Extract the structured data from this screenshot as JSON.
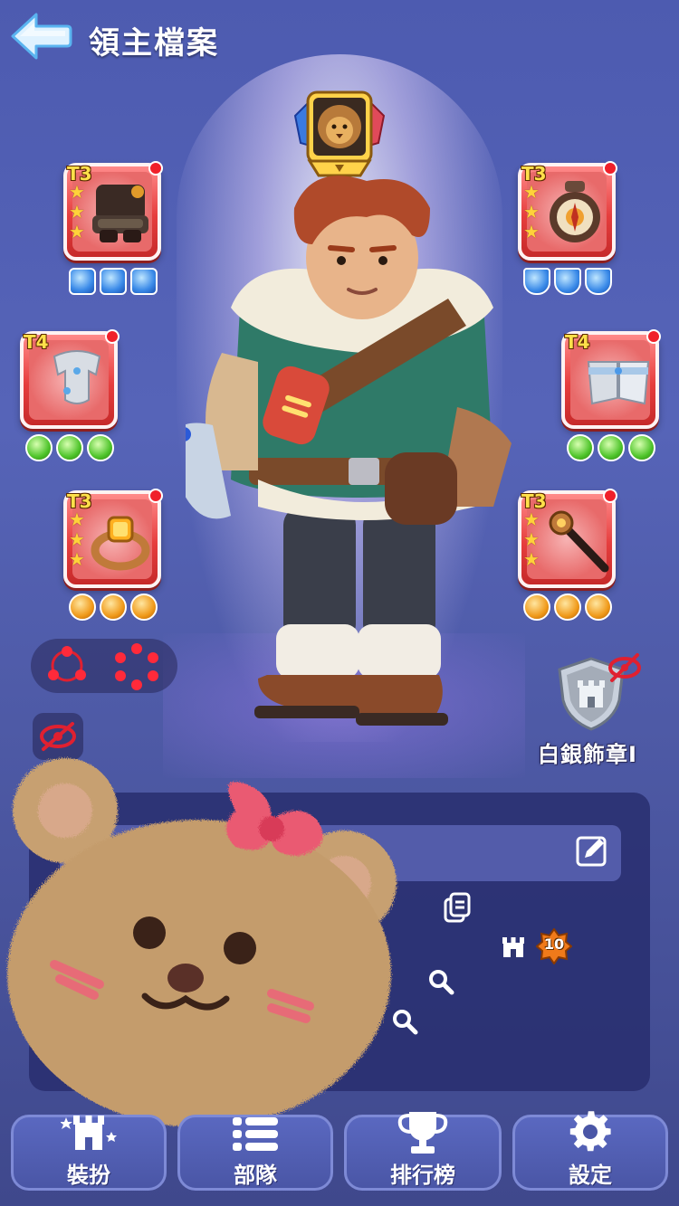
{
  "header": {
    "title": "領主檔案"
  },
  "equipment": {
    "left": [
      {
        "tier": "T3",
        "stars": 3,
        "gem_type": "blue"
      },
      {
        "tier": "T4",
        "stars": 0,
        "gem_type": "green"
      },
      {
        "tier": "T3",
        "stars": 3,
        "gem_type": "orange"
      }
    ],
    "right": [
      {
        "tier": "T3",
        "stars": 3,
        "gem_type": "blue"
      },
      {
        "tier": "T4",
        "stars": 0,
        "gem_type": "green"
      },
      {
        "tier": "T3",
        "stars": 3,
        "gem_type": "orange"
      }
    ]
  },
  "badge": {
    "label": "白銀飾章Ⅰ"
  },
  "info": {
    "castle_level": "10",
    "colon_text": "："
  },
  "nav": {
    "items": [
      {
        "label": "裝扮",
        "icon": "castle-star-icon"
      },
      {
        "label": "部隊",
        "icon": "troops-icon"
      },
      {
        "label": "排行榜",
        "icon": "trophy-icon"
      },
      {
        "label": "設定",
        "icon": "gear-icon"
      }
    ]
  },
  "colors": {
    "background": "#4d5bb0",
    "slot_red": "#e63d3d",
    "panel": "#2e3470",
    "accent_gold": "#ffd23a"
  }
}
